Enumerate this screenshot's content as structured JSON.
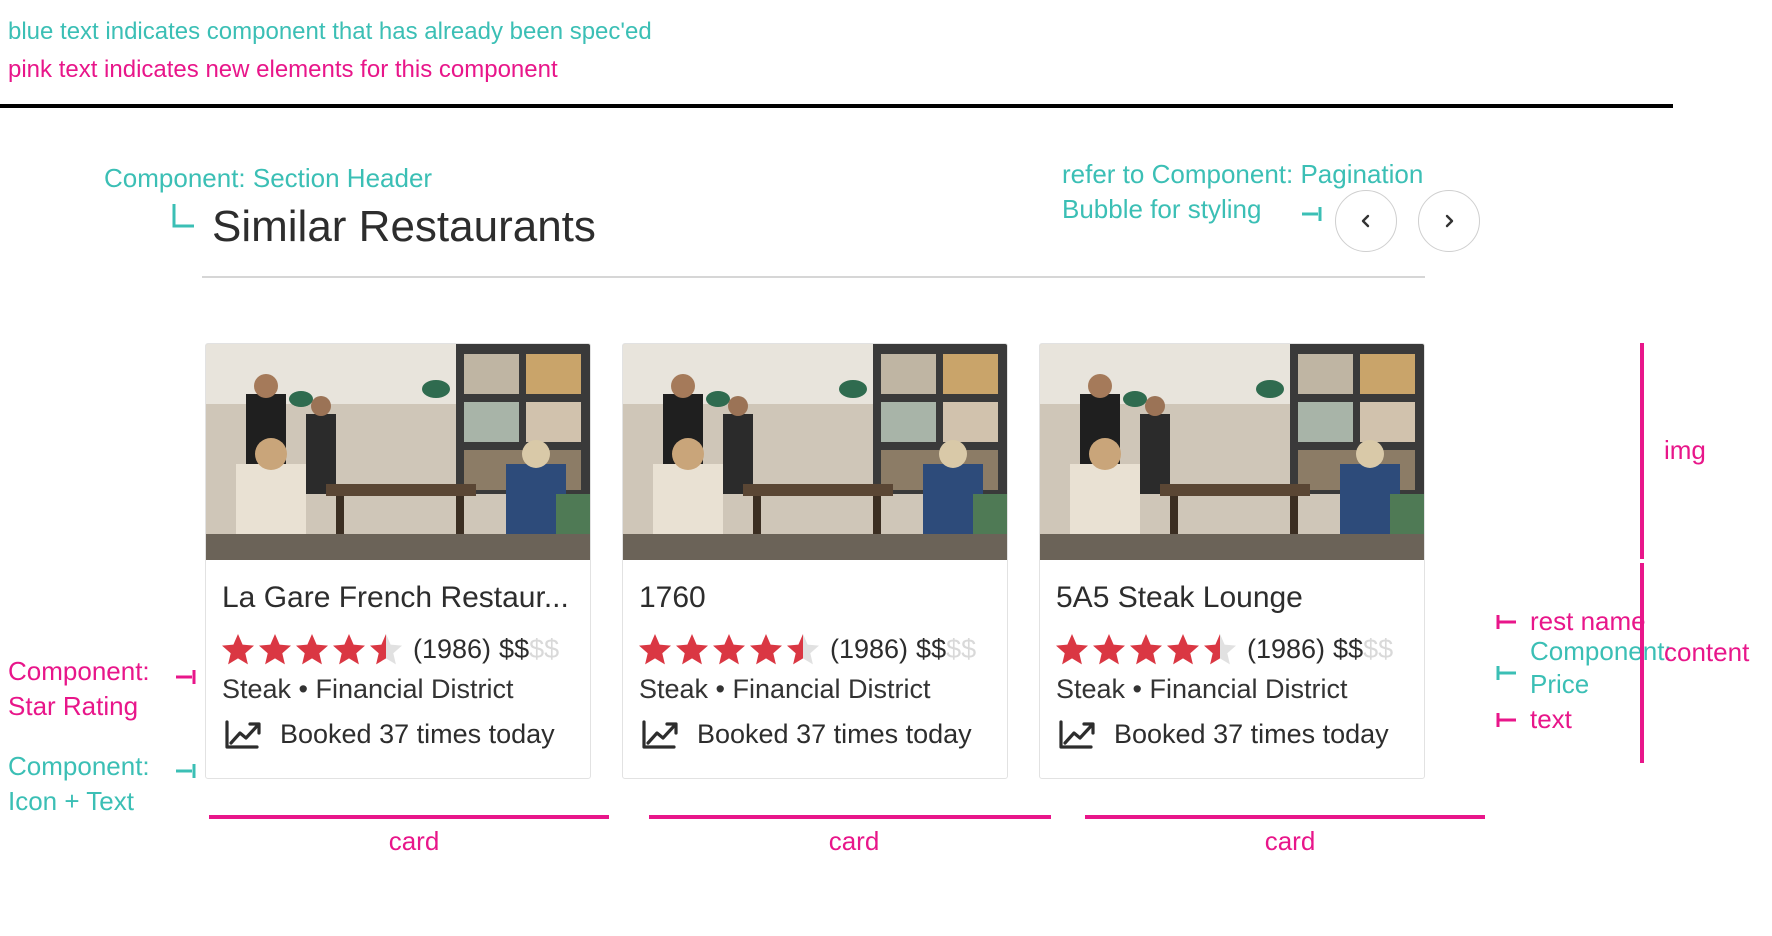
{
  "legend": {
    "blue_line": "blue text indicates component that has already been spec'ed",
    "pink_line": "pink text indicates new elements for this component"
  },
  "annotations": {
    "section_header_label": "Component: Section Header",
    "pagination_label_line1": "refer to Component: Pagination",
    "pagination_label_line2": "Bubble for styling",
    "star_rating_line1": "Component:",
    "star_rating_line2": "Star Rating",
    "icon_text_line1": "Component:",
    "icon_text_line2": "Icon + Text",
    "rest_name": "rest name",
    "price_line1": "Component:",
    "price_line2": "Price",
    "text": "text",
    "img": "img",
    "content": "content",
    "card_label": "card"
  },
  "section": {
    "title": "Similar Restaurants"
  },
  "pagination": {
    "prev_icon": "chevron-left-icon",
    "next_icon": "chevron-right-icon"
  },
  "cards": [
    {
      "name": "La Gare French Restaur...",
      "rating": 4.5,
      "reviews": "(1986)",
      "price_active": "$$",
      "price_inactive": "$$",
      "meta": "Steak • Financial District",
      "booked": "Booked 37 times today"
    },
    {
      "name": "1760",
      "rating": 4.5,
      "reviews": "(1986)",
      "price_active": "$$",
      "price_inactive": "$$",
      "meta": "Steak • Financial District",
      "booked": "Booked 37 times today"
    },
    {
      "name": "5A5 Steak Lounge",
      "rating": 4.5,
      "reviews": "(1986)",
      "price_active": "$$",
      "price_inactive": "$$",
      "meta": "Steak • Financial District",
      "booked": "Booked 37 times today"
    }
  ],
  "colors": {
    "spec_teal": "#3bbfb5",
    "new_pink": "#e8168a",
    "star_red": "#da3743",
    "star_empty": "#e1e1e1",
    "text_dark": "#2d2d2d"
  }
}
